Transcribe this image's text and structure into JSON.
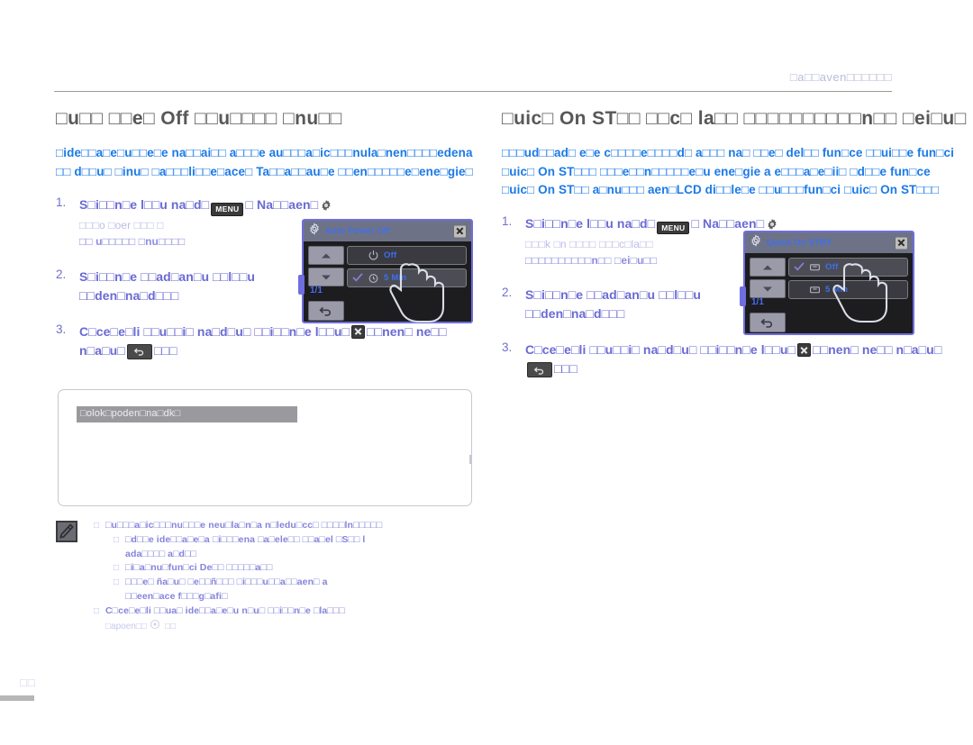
{
  "header": {
    "title": "□a□□aven□□□□□□"
  },
  "left_column": {
    "section_title": "□u□□ □□e□ Off □□u□□□□ □nu□□",
    "intro": "□ide□□a□e□u□□e□e na□□ai□□ a□□□e au□□□a□ic□□□nula□nen□□□□edena □□ d□□u□ □inu□ □a□□□li□□e□ace□ Ta□□a□□au□e □□en□□□□□e□ene□gie□",
    "steps": [
      {
        "num": "1.",
        "main_a": "S□i□□n□e l□□u na□d□",
        "main_b": "□ Na□□aen□",
        "sub1": "□□□o □oer □□□         □",
        "sub2": "□□ u□□□□□ □nu□□□□"
      },
      {
        "num": "2.",
        "main_a": "S□i□□n□e □□ad□an□u □□l□□u",
        "main_b": "□□den□na□d□□□"
      },
      {
        "num": "3.",
        "main_a": "C□ce□e□li □□u□□i□ na□d□u□ □□i□□n□e l□□u□",
        "main_b": "□□nen□ ne□□ n□a□u□",
        "main_c": "□□□"
      }
    ]
  },
  "right_column": {
    "section_title": "□uic□ On ST□□ □□c□ la□□ □□□□□□□□□□n□□ □ei□u□",
    "intro": "□□□ud□□ad□ e□e c□□□□e□□□□d□ a□□□ na□ □□e□ del□□ fun□ce □□ui□□e fun□ci □uic□ On ST□□□ □□□e□□n□□□□□e□u ene□gie a e□□□a□e□ii□ □d□□e fun□ce □uic□ On ST□□ a□nu□□□ aen□LCD di□□le□e □□u□□□fun□ci □uic□ On ST□□□",
    "steps": [
      {
        "num": "1.",
        "main_a": "S□i□□n□e l□□u na□d□",
        "main_b": "□ Na□□aen□",
        "sub1": "□□□k □n □□□□    □□□c□la□□",
        "sub2": "□□□□□□□□□□n□□ □ei□u□□"
      },
      {
        "num": "2.",
        "main_a": "S□i□□n□e □□ad□an□u □□l□□u",
        "main_b": "□□den□na□d□□□"
      },
      {
        "num": "3.",
        "main_a": "C□ce□e□li □□u□□i□ na□d□u□ □□i□□n□e l□□u□",
        "main_b": "□□nen□ ne□□ n□a□u□",
        "main_c": "□□□"
      }
    ]
  },
  "screenshot_frame": {
    "bar_text": "□olok□poden□na□dk□"
  },
  "lcd_left": {
    "title": "Auto Power Off",
    "page_indicator": "1/1",
    "options": [
      {
        "label": "Off",
        "checked": false,
        "icon": "power-off-icon"
      },
      {
        "label": "5 Min",
        "checked": true,
        "icon": "clock-5min-icon"
      }
    ]
  },
  "lcd_right": {
    "title": "Quick On STBY",
    "page_indicator": "1/1",
    "options": [
      {
        "label": "Off",
        "checked": true,
        "icon": "standby-off-icon"
      },
      {
        "label": "5 Min",
        "checked": false,
        "icon": "standby-5min-icon"
      }
    ]
  },
  "notes": {
    "line1": "□u□□□a□ic□□□nu□□□e neu□la□n□a n□ledu□cc□ □□□□ln□□□□□",
    "line2": "□d□□e ide□□a□e□a □i□□□ena □a□ele□□ □□a□el □S□□ l",
    "line2b": "ada□□□□ a□d□□",
    "line3": "□i□a□nu□fun□ci De□□ □□□□□a□□",
    "line4": "□□□e□ ña□u□ □e□□ñ□□□ □i□□□u□□a□□aen□ a",
    "line4b": "□□een□ace f□□□g□afi□",
    "line5": "C□ce□e□li □□ua□ ide□□a□e□u n□u□ □□i□□n□e □la□□□",
    "line5b": "□apoen□□"
  },
  "footer": {
    "page_number": "□□"
  },
  "colors": {
    "intro_blue": "#1b7ae6",
    "step_purple": "#6a6ad4",
    "lcd_border": "#6f6ede",
    "lcd_text_blue": "#3d6ff0",
    "header_rule": "#9a9a9a"
  }
}
